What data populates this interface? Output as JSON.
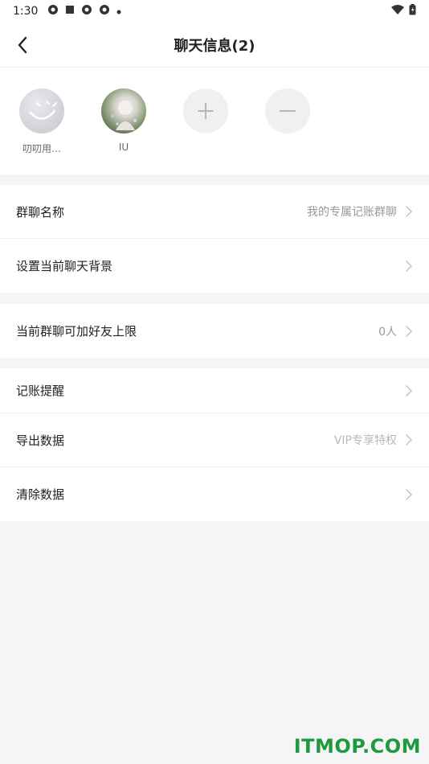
{
  "status_bar": {
    "time": "1:30",
    "icons": [
      "app-icon",
      "square-icon",
      "app-icon",
      "app-icon",
      "dot-icon"
    ],
    "right_icons": [
      "wifi-icon",
      "battery-icon"
    ]
  },
  "nav": {
    "title": "聊天信息(2)"
  },
  "members": [
    {
      "name": "叨叨用…",
      "avatar": "smile-avatar"
    },
    {
      "name": "IU",
      "avatar": "photo-avatar"
    }
  ],
  "member_actions": [
    "add-member",
    "remove-member"
  ],
  "groups": [
    {
      "rows": [
        {
          "label": "群聊名称",
          "value": "我的专属记账群聊"
        },
        {
          "label": "设置当前聊天背景",
          "value": ""
        }
      ]
    },
    {
      "rows": [
        {
          "label": "当前群聊可加好友上限",
          "value": "0人"
        }
      ]
    },
    {
      "rows": [
        {
          "label": "记账提醒",
          "value": ""
        },
        {
          "label": "导出数据",
          "value": "VIP专享特权"
        },
        {
          "label": "清除数据",
          "value": ""
        }
      ]
    }
  ],
  "watermark": "ITMOP.COM",
  "colors": {
    "background": "#f5f5f7",
    "card": "#ffffff",
    "secondary_text": "#9a9a9a",
    "watermark": "#1e9a3e"
  }
}
